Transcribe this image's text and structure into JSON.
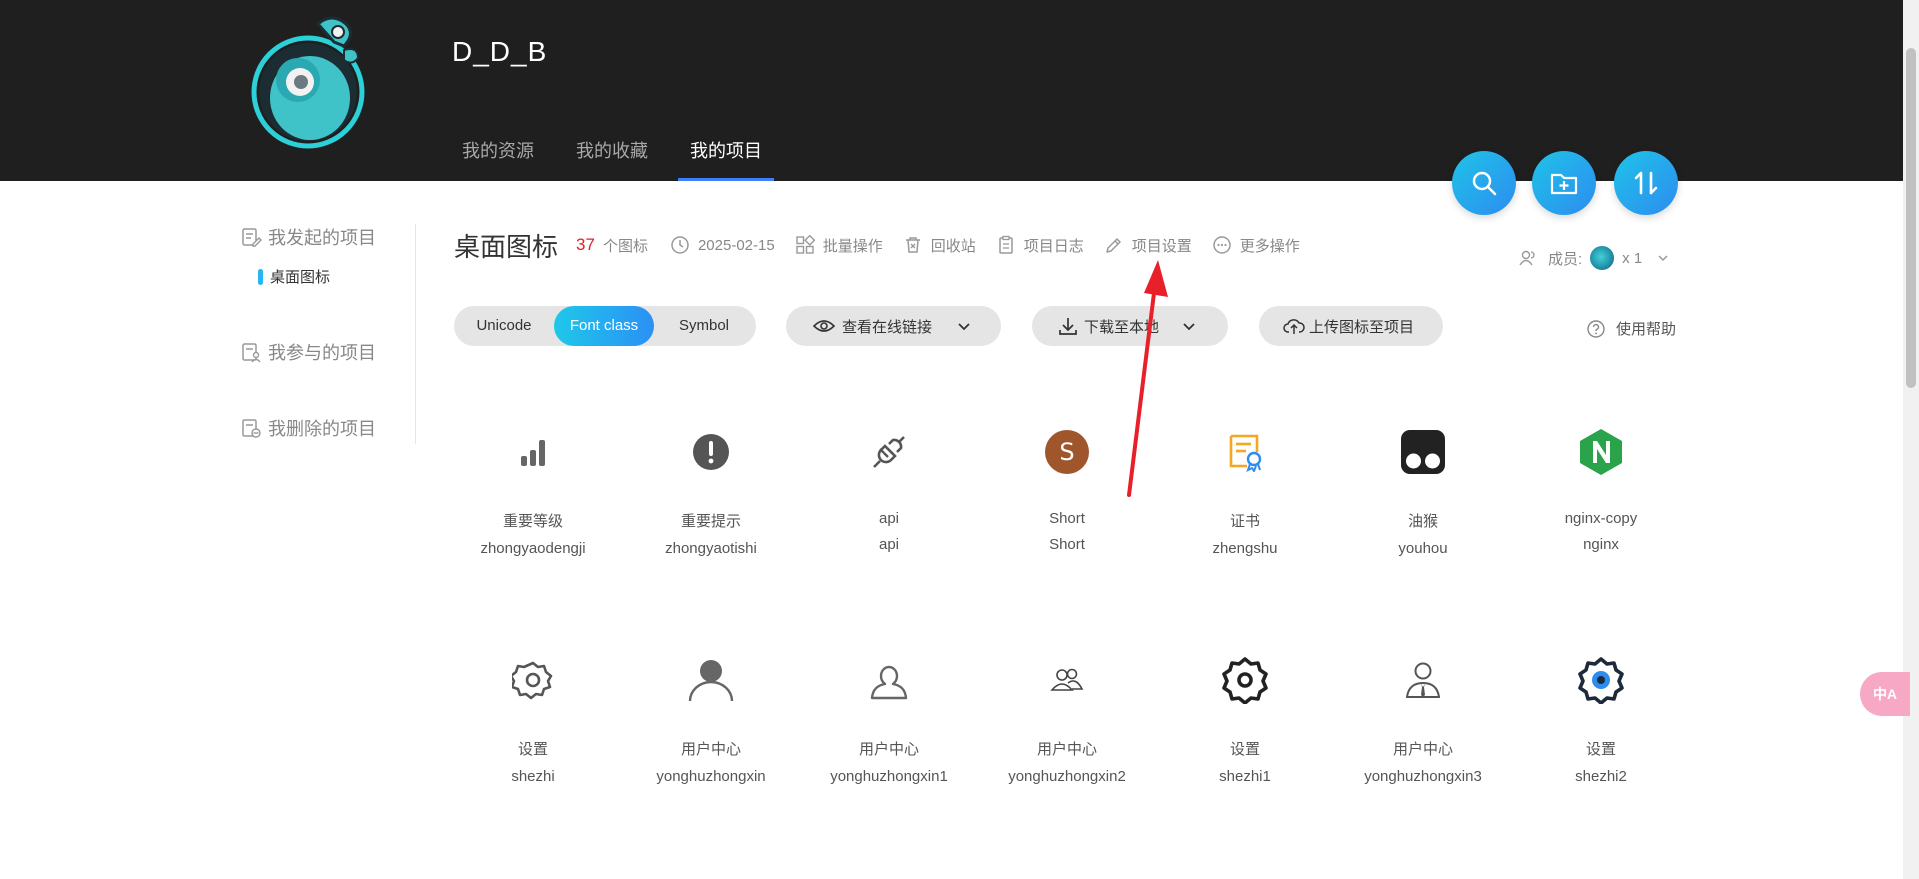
{
  "header": {
    "user_name": "D_D_B",
    "nav": [
      "我的资源",
      "我的收藏",
      "我的项目"
    ],
    "active_nav": 2,
    "actions": [
      "search-icon",
      "new-folder-icon",
      "sort-icon"
    ]
  },
  "sidebar": {
    "initiated": "我发起的项目",
    "project": "桌面图标",
    "participated": "我参与的项目",
    "deleted": "我删除的项目"
  },
  "project": {
    "title": "桌面图标",
    "count": "37",
    "count_suffix": "个图标",
    "date": "2025-02-15",
    "batch": "批量操作",
    "recycle": "回收站",
    "log": "项目日志",
    "settings": "项目设置",
    "more": "更多操作",
    "members_label": "成员:",
    "members_count": "x 1"
  },
  "toolbar": {
    "seg": [
      "Unicode",
      "Font class",
      "Symbol"
    ],
    "active_seg": 1,
    "view_link": "查看在线链接",
    "download": "下载至本地",
    "upload": "上传图标至项目",
    "help": "使用帮助"
  },
  "icons": [
    {
      "cn": "重要等级",
      "en": "zhongyaodengji",
      "icon": "signal-bars-icon"
    },
    {
      "cn": "重要提示",
      "en": "zhongyaotishi",
      "icon": "exclamation-icon"
    },
    {
      "cn": "api",
      "en": "api",
      "icon": "plug-icon"
    },
    {
      "cn": "Short",
      "en": "Short",
      "icon": "letter-s-icon"
    },
    {
      "cn": "证书",
      "en": "zhengshu",
      "icon": "certificate-icon"
    },
    {
      "cn": "油猴",
      "en": "youhou",
      "icon": "tampermonkey-icon"
    },
    {
      "cn": "nginx-copy",
      "en": "nginx",
      "icon": "nginx-icon"
    },
    {
      "cn": "设置",
      "en": "shezhi",
      "icon": "gear-outline-icon"
    },
    {
      "cn": "用户中心",
      "en": "yonghuzhongxin",
      "icon": "user-solid-icon"
    },
    {
      "cn": "用户中心",
      "en": "yonghuzhongxin1",
      "icon": "user-outline-icon"
    },
    {
      "cn": "用户中心",
      "en": "yonghuzhongxin2",
      "icon": "user-group-icon"
    },
    {
      "cn": "设置",
      "en": "shezhi1",
      "icon": "gear-bold-icon"
    },
    {
      "cn": "用户中心",
      "en": "yonghuzhongxin3",
      "icon": "user-tie-icon"
    },
    {
      "cn": "设置",
      "en": "shezhi2",
      "icon": "gear-color-icon"
    }
  ],
  "colors": {
    "header_bg": "#1f1f1f",
    "accent": "#2b90f5",
    "count_red": "#e0202b",
    "annotation_arrow": "#e8202a"
  },
  "translate_label": "中A"
}
